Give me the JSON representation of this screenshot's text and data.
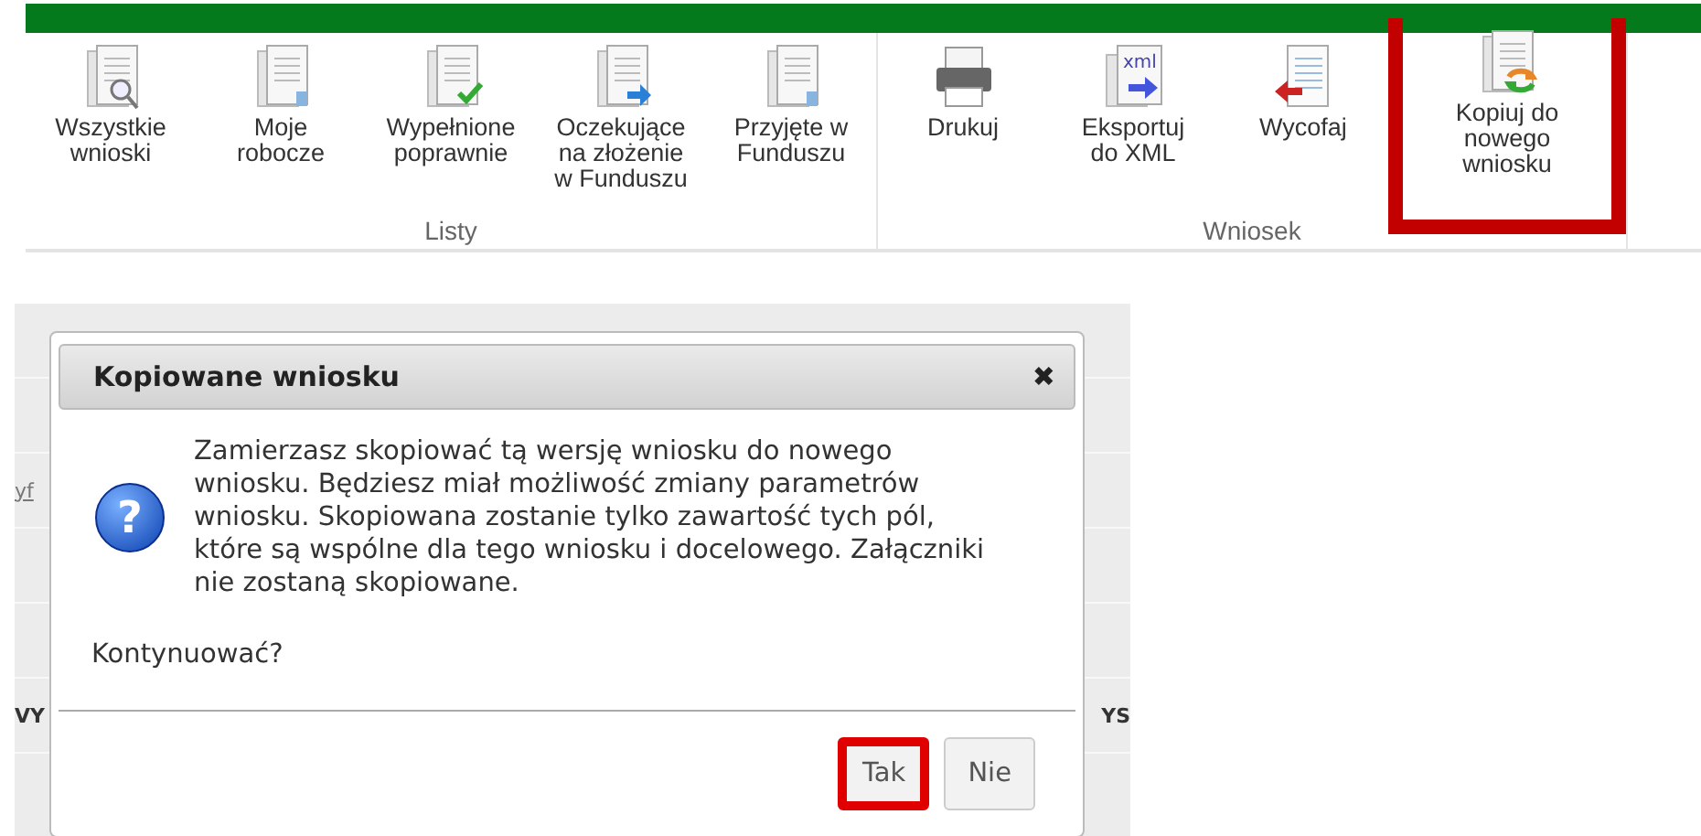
{
  "ribbon": {
    "groups": [
      {
        "label": "Listy",
        "items": [
          {
            "kind": "search",
            "label": "Wszystkie wnioski",
            "highlighted": false
          },
          {
            "kind": "plain",
            "label": "Moje robocze",
            "highlighted": false
          },
          {
            "kind": "check",
            "label": "Wypełnione poprawnie",
            "highlighted": false
          },
          {
            "kind": "send",
            "label": "Oczekujące na złożenie w Funduszu",
            "highlighted": false
          },
          {
            "kind": "plain",
            "label": "Przyjęte w Funduszu",
            "highlighted": false
          }
        ]
      },
      {
        "label": "Wniosek",
        "items": [
          {
            "kind": "print",
            "label": "Drukuj",
            "highlighted": false
          },
          {
            "kind": "xml",
            "label": "Eksportuj do XML",
            "icon_text": "xml",
            "highlighted": false
          },
          {
            "kind": "withdraw",
            "label": "Wycofaj",
            "highlighted": false
          },
          {
            "kind": "copy",
            "label": "Kopiuj do nowego wniosku",
            "highlighted": true
          }
        ]
      }
    ]
  },
  "background": {
    "link_fragment": "yf",
    "left_fragment": "VY",
    "right_fragment": "YS"
  },
  "dialog": {
    "title": "Kopiowane wniosku",
    "close": "✖",
    "message": "Zamierzasz skopiować tą wersję wniosku do nowego wniosku. Będziesz miał możliwość zmiany parametrów wniosku. Skopiowana zostanie tylko zawartość tych pól, które są wspólne dla tego wniosku i docelowego. Załączniki nie zostaną skopiowane.",
    "question": "Kontynuować?",
    "icon_text": "?",
    "buttons": [
      {
        "label": "Tak",
        "highlighted": true
      },
      {
        "label": "Nie",
        "highlighted": false
      }
    ]
  }
}
